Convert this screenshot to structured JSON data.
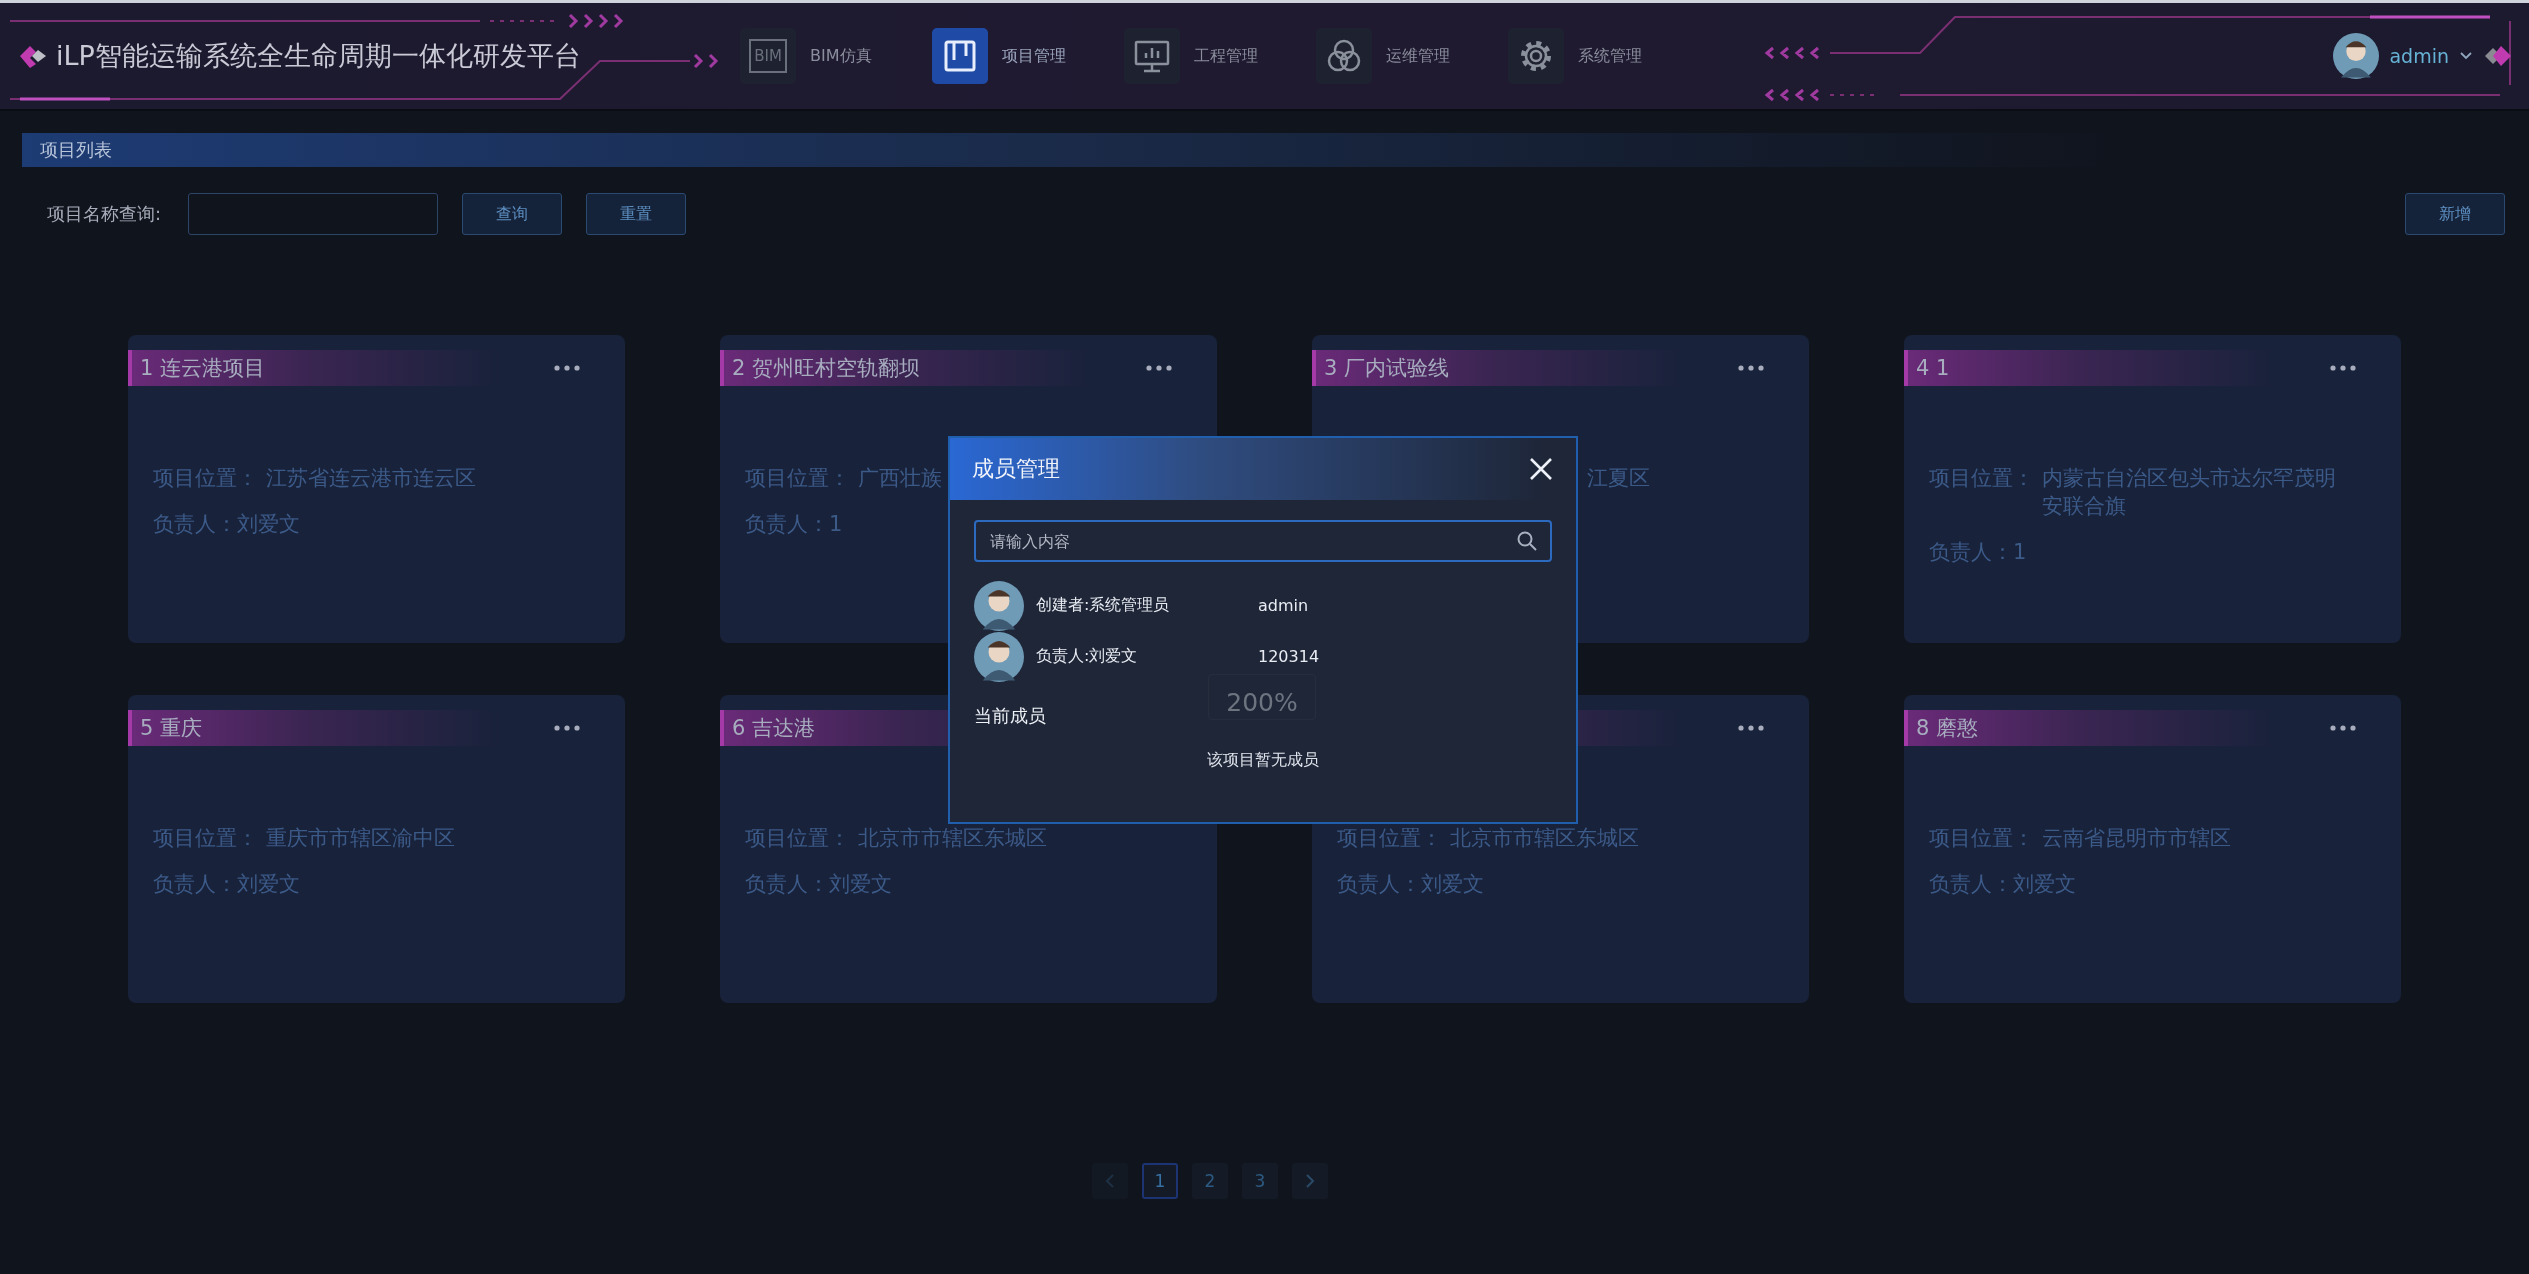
{
  "header": {
    "title": "iLP智能运输系统全生命周期一体化研发平台",
    "nav": [
      {
        "label": "BIM仿真",
        "kind": "text",
        "icon_text": "BIM",
        "selected": false
      },
      {
        "label": "项目管理",
        "kind": "board",
        "selected": true
      },
      {
        "label": "工程管理",
        "kind": "monitor",
        "selected": false
      },
      {
        "label": "运维管理",
        "kind": "circles",
        "selected": false
      },
      {
        "label": "系统管理",
        "kind": "gear",
        "selected": false
      }
    ],
    "user": {
      "name": "admin"
    }
  },
  "section_title": "项目列表",
  "search": {
    "label": "项目名称查询:",
    "buttons": [
      "查询",
      "重置"
    ],
    "add_button": "新增"
  },
  "cards": [
    {
      "title": "1 连云港项目",
      "location": {
        "kind": "split",
        "label": "项目位置：",
        "value": "江苏省连云港市连云区"
      },
      "owner": "负责人：刘爱文",
      "more_menu": true
    },
    {
      "title": "2 贺州旺村空轨翻坝",
      "location": {
        "kind": "split",
        "label": "项目位置：",
        "value": "广西壮族"
      },
      "owner": "负责人：1",
      "more_menu": true
    },
    {
      "title": "3 厂内试验线",
      "location": {
        "kind": "tail",
        "value": "江夏区"
      },
      "more_menu": true
    },
    {
      "title": "4 1",
      "location": {
        "kind": "split",
        "label": "项目位置：",
        "value": "内蒙古自治区包头市达尔罕茂明安联合旗"
      },
      "owner": "负责人：1",
      "more_menu": true
    },
    {
      "title": "5 重庆",
      "location": {
        "kind": "split",
        "label": "项目位置：",
        "value": "重庆市市辖区渝中区"
      },
      "owner": "负责人：刘爱文",
      "more_menu": true
    },
    {
      "title": "6 吉达港",
      "location": {
        "kind": "split",
        "label": "项目位置：",
        "value": "北京市市辖区东城区"
      },
      "owner": "负责人：刘爱文"
    },
    {
      "location": {
        "kind": "split",
        "label": "项目位置：",
        "value": "北京市市辖区东城区"
      },
      "owner": "负责人：刘爱文",
      "more_menu": true
    },
    {
      "title": "8 磨憨",
      "location": {
        "kind": "split",
        "label": "项目位置：",
        "value": "云南省昆明市市辖区"
      },
      "owner": "负责人：刘爱文",
      "more_menu": true
    }
  ],
  "pagination": {
    "pages": [
      {
        "label": "1",
        "selected": true
      },
      {
        "label": "2",
        "selected": false
      },
      {
        "label": "3",
        "selected": false
      }
    ]
  },
  "dialog": {
    "title": "成员管理",
    "search_placeholder": "请输入内容",
    "members": [
      {
        "role": "创建者:系统管理员",
        "account": "admin"
      },
      {
        "role": "负责人:刘爱文",
        "account": "120314"
      }
    ],
    "current_heading": "当前成员",
    "empty_text": "该项目暂无成员"
  },
  "zoom_indicator": "200%"
}
